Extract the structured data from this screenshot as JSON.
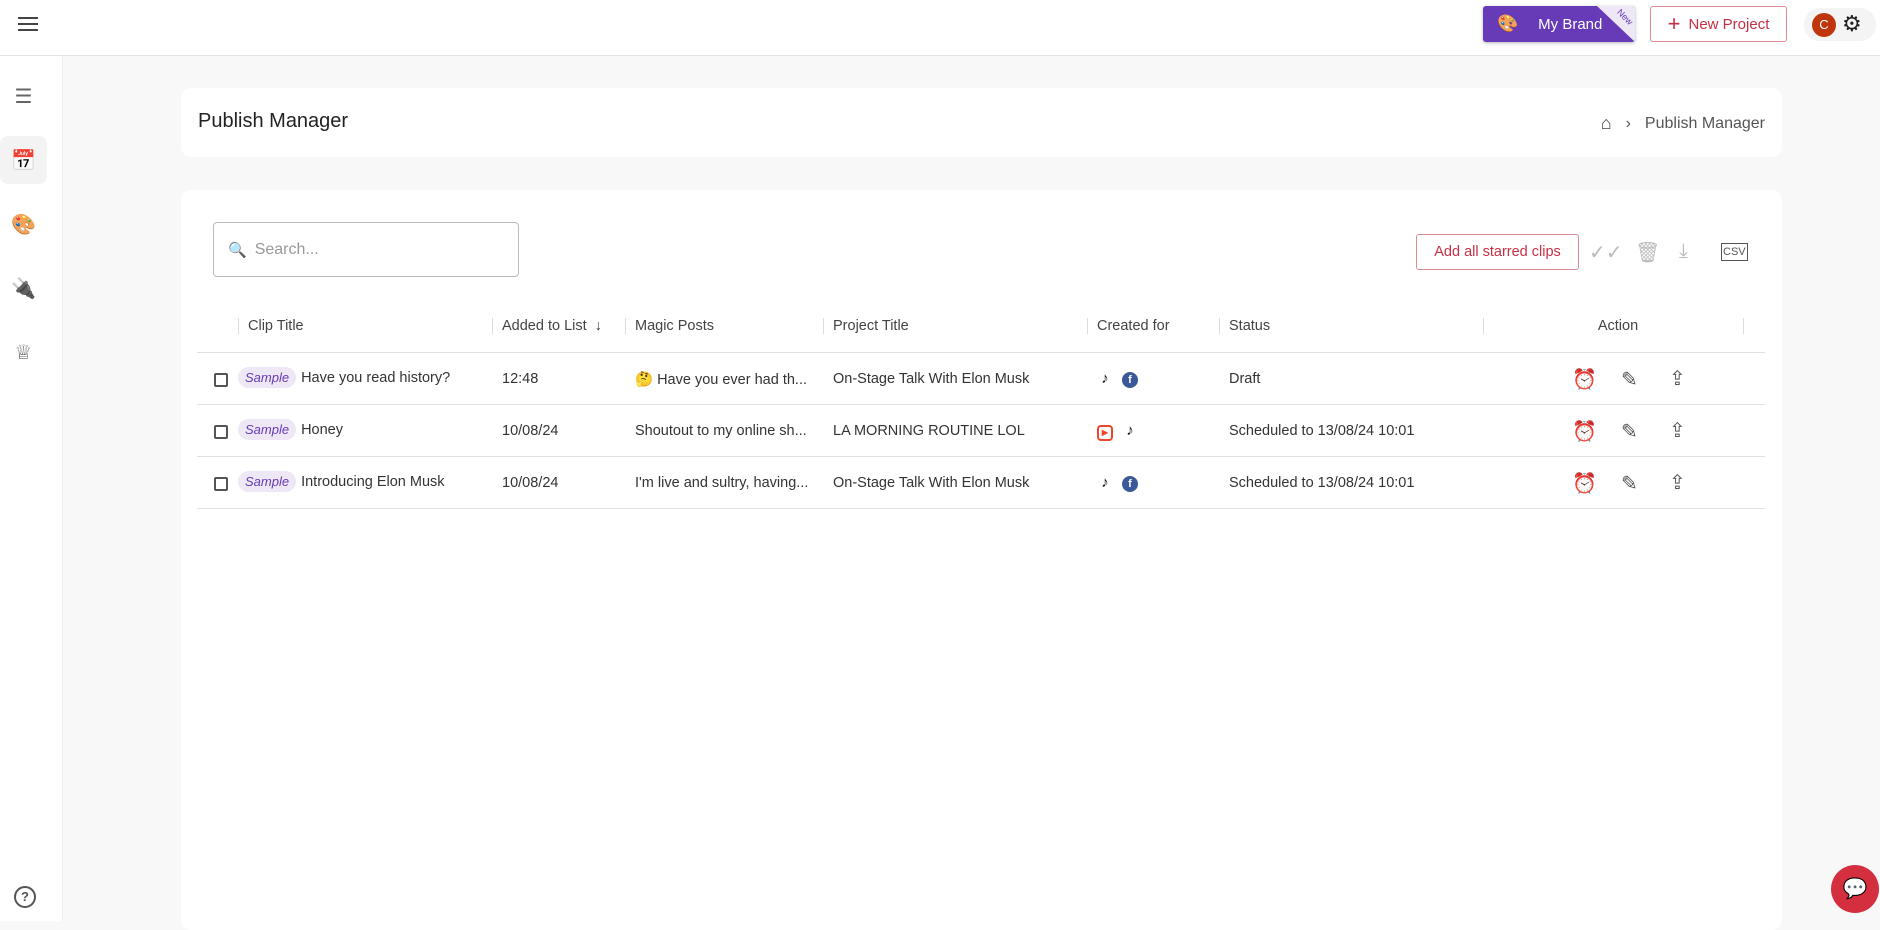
{
  "topbar": {
    "my_brand": "My Brand",
    "new_badge": "New",
    "new_project": "New Project",
    "avatar_initial": "C"
  },
  "sidebar": {
    "items": [
      {
        "icon": "projects-icon"
      },
      {
        "icon": "calendar-icon",
        "active": true
      },
      {
        "icon": "palette-icon"
      },
      {
        "icon": "plug-icon"
      },
      {
        "icon": "crown-icon"
      }
    ],
    "help": "?"
  },
  "header": {
    "title": "Publish Manager",
    "breadcrumb": [
      "Publish Manager"
    ]
  },
  "toolbar": {
    "search_placeholder": "Search...",
    "add_starred": "Add all starred clips"
  },
  "table": {
    "columns": [
      "Clip Title",
      "Added to List",
      "Magic Posts",
      "Project Title",
      "Created for",
      "Status",
      "Action"
    ],
    "sort_column": "Added to List",
    "sort_dir": "desc",
    "tag": "Sample",
    "rows": [
      {
        "clip": "Have you read history?",
        "added": "12:48",
        "magic": "🤔 Have you ever had th...",
        "project": "On-Stage Talk With Elon Musk",
        "platforms": [
          "tiktok",
          "facebook"
        ],
        "status": "Draft",
        "scheduled": false
      },
      {
        "clip": "Honey",
        "added": "10/08/24",
        "magic": "Shoutout to my online sh...",
        "project": "LA MORNING ROUTINE LOL",
        "platforms": [
          "instagram-reels",
          "tiktok"
        ],
        "status": "Scheduled to 13/08/24 10:01",
        "scheduled": true
      },
      {
        "clip": "Introducing Elon Musk",
        "added": "10/08/24",
        "magic": "I'm live and sultry, having...",
        "project": "On-Stage Talk With Elon Musk",
        "platforms": [
          "tiktok",
          "facebook"
        ],
        "status": "Scheduled to 13/08/24 10:01",
        "scheduled": true
      }
    ]
  },
  "colors": {
    "brand": "#673ab7",
    "accent": "#c62f44",
    "scheduled": "#d32f3f"
  }
}
